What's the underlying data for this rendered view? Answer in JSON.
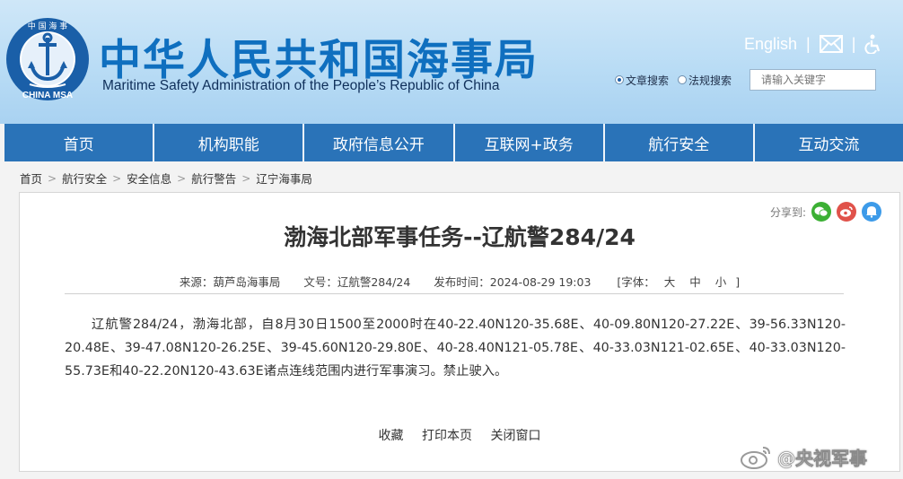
{
  "header": {
    "title_cn": "中华人民共和国海事局",
    "title_en": "Maritime Safety Administration of the People’s Republic of China",
    "logo_text_top": "中 国 海 事",
    "logo_text_bottom": "CHINA MSA",
    "english_link": "English",
    "search": {
      "option_article": "文章搜索",
      "option_law": "法规搜索",
      "placeholder": "请输入关键字"
    }
  },
  "nav": {
    "items": [
      "首页",
      "机构职能",
      "政府信息公开",
      "互联网+政务",
      "航行安全",
      "互动交流"
    ]
  },
  "breadcrumb": {
    "items": [
      "首页",
      "航行安全",
      "安全信息",
      "航行警告",
      "辽宁海事局"
    ],
    "separator": ">"
  },
  "article": {
    "share_label": "分享到:",
    "title": "渤海北部军事任务--辽航警284/24",
    "meta": {
      "source": "来源：葫芦岛海事局",
      "doc_no": "文号：辽航警284/24",
      "publish_time": "发布时间：2024-08-29 19:03",
      "font_label": "[字体：",
      "font_large": "大",
      "font_medium": "中",
      "font_small": "小",
      "font_close": "]"
    },
    "body": "辽航警284/24，渤海北部，自8月30日1500至2000时在40-22.40N120-35.68E、40-09.80N120-27.22E、39-56.33N120-20.48E、39-47.08N120-26.25E、39-45.60N120-29.80E、40-28.40N121-05.78E、40-33.03N121-02.65E、40-33.03N120-55.73E和40-22.20N120-43.63E诸点连线范围内进行军事演习。禁止驶入。",
    "actions": {
      "favorite": "收藏",
      "print": "打印本页",
      "close": "关闭窗口"
    }
  },
  "watermark": {
    "text": "@央视军事"
  },
  "colors": {
    "nav_bg": "#2a73b8",
    "title_blue": "#0f6fbf",
    "header_bg": "#bfe0f6"
  }
}
